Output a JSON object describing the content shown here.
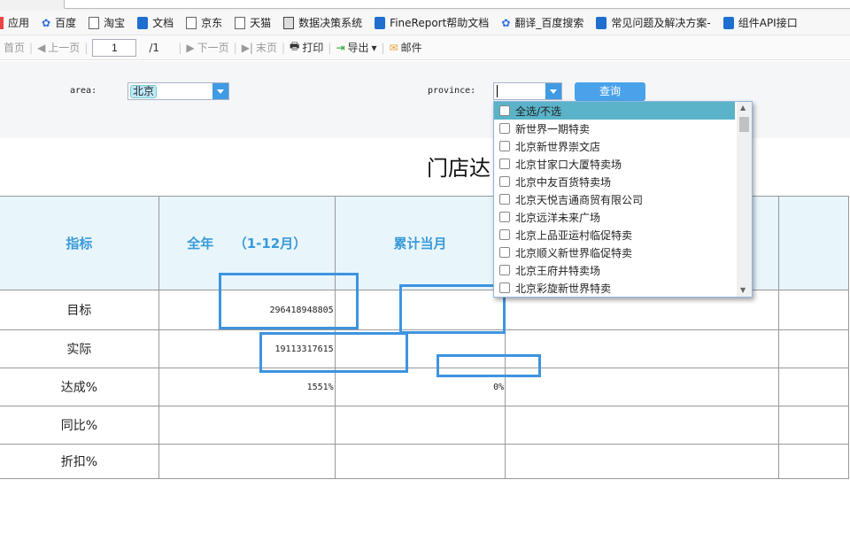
{
  "bookmarks": [
    {
      "label": "应用",
      "icon": "apps-icon"
    },
    {
      "label": "百度",
      "icon": "baidu-paw-icon"
    },
    {
      "label": "淘宝",
      "icon": "page-icon"
    },
    {
      "label": "文档",
      "icon": "finereport-icon"
    },
    {
      "label": "京东",
      "icon": "page-icon"
    },
    {
      "label": "天猫",
      "icon": "page-icon"
    },
    {
      "label": "数据决策系统",
      "icon": "decision-icon"
    },
    {
      "label": "FineReport帮助文档",
      "icon": "finereport-icon"
    },
    {
      "label": "翻译_百度搜索",
      "icon": "baidu-paw-icon"
    },
    {
      "label": "常见问题及解决方案-",
      "icon": "finereport-icon"
    },
    {
      "label": "组件API接口",
      "icon": "finereport-icon"
    }
  ],
  "toolbar": {
    "first": "首页",
    "prev": "上一页",
    "page": "1",
    "total": "/1",
    "next": "下一页",
    "last": "末页",
    "print": "打印",
    "export": "导出",
    "mail": "邮件"
  },
  "params": {
    "area_label": "area:",
    "area_value": "北京",
    "province_label": "province:",
    "province_value": "",
    "query": "查询"
  },
  "dropdown": {
    "options": [
      "全选/不选",
      "新世界一期特卖",
      "北京新世界崇文店",
      "北京甘家口大厦特卖场",
      "北京中友百货特卖场",
      "北京天悦吉通商贸有限公司",
      "北京远洋未来广场",
      "北京上品亚运村临促特卖",
      "北京顺义新世界临促特卖",
      "北京王府井特卖场",
      "北京彩旋新世界特卖"
    ]
  },
  "report": {
    "title": "门店达",
    "headers": [
      "指标",
      "全年　　（1-12月）",
      "累计当月"
    ],
    "rows": [
      {
        "label": "目标",
        "year": "296418948805",
        "month": ""
      },
      {
        "label": "实际",
        "year": "19113317615",
        "month": ""
      },
      {
        "label": "达成%",
        "year": "1551%",
        "month": "0%"
      },
      {
        "label": "同比%",
        "year": "",
        "month": ""
      },
      {
        "label": "折扣%",
        "year": "",
        "month": ""
      }
    ]
  }
}
